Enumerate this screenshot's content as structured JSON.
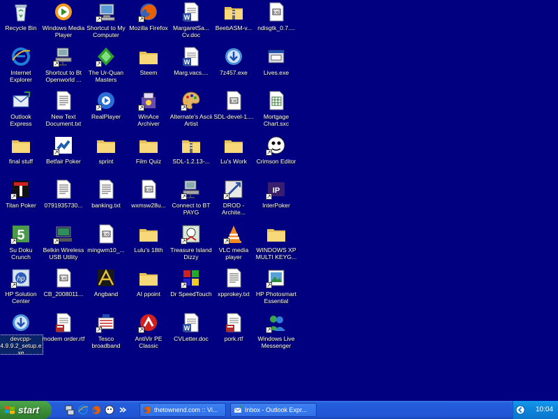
{
  "desktop": {
    "icons": [
      {
        "label": "Recycle Bin",
        "icon": "recycle-bin-icon",
        "shortcut": false
      },
      {
        "label": "Windows Media Player",
        "icon": "media-player-icon",
        "shortcut": false
      },
      {
        "label": "Shortcut to My Computer",
        "icon": "computer-icon",
        "shortcut": true
      },
      {
        "label": "Mozilla Firefox",
        "icon": "firefox-icon",
        "shortcut": true
      },
      {
        "label": "MargaretSa... Cv.doc",
        "icon": "word-doc-icon",
        "shortcut": false
      },
      {
        "label": "BeebASM-v...",
        "icon": "zip-folder-icon",
        "shortcut": false
      },
      {
        "label": "ndisgtk_0.7....",
        "icon": "file-icon",
        "shortcut": false
      },
      {
        "label": "Internet Explorer",
        "icon": "ie-icon",
        "shortcut": false
      },
      {
        "label": "Shortcut to Bt Openworld ...",
        "icon": "network-computer-icon",
        "shortcut": true
      },
      {
        "label": "The Ur-Quan Masters",
        "icon": "game-icon",
        "shortcut": true
      },
      {
        "label": "Steem",
        "icon": "folder-icon",
        "shortcut": false
      },
      {
        "label": "Marg.vacs....",
        "icon": "word-doc-icon",
        "shortcut": false
      },
      {
        "label": "7z457.exe",
        "icon": "installer-icon",
        "shortcut": false
      },
      {
        "label": "Lives.exe",
        "icon": "exe-icon",
        "shortcut": false
      },
      {
        "label": "Outlook Express",
        "icon": "outlook-icon",
        "shortcut": false
      },
      {
        "label": "New Text Document.txt",
        "icon": "text-file-icon",
        "shortcut": false
      },
      {
        "label": "RealPlayer",
        "icon": "realplayer-icon",
        "shortcut": true
      },
      {
        "label": "WinAce Archiver",
        "icon": "winace-icon",
        "shortcut": true
      },
      {
        "label": "Alternate's Ascii Artist",
        "icon": "palette-icon",
        "shortcut": true
      },
      {
        "label": "SDL-devel-1....",
        "icon": "file-icon",
        "shortcut": false
      },
      {
        "label": "Mortgage Chart.sxc",
        "icon": "spreadsheet-icon",
        "shortcut": false
      },
      {
        "label": "final stuff",
        "icon": "folder-icon",
        "shortcut": false
      },
      {
        "label": "Betfair Poker",
        "icon": "betfair-icon",
        "shortcut": true
      },
      {
        "label": "sprint",
        "icon": "folder-icon",
        "shortcut": false
      },
      {
        "label": "Film Quiz",
        "icon": "folder-icon",
        "shortcut": false
      },
      {
        "label": "SDL-1.2.13-...",
        "icon": "zip-folder-icon",
        "shortcut": false
      },
      {
        "label": "Lu's Work",
        "icon": "folder-icon",
        "shortcut": false
      },
      {
        "label": "Crimson Editor",
        "icon": "crimson-editor-icon",
        "shortcut": true
      },
      {
        "label": "Titan Poker",
        "icon": "titan-poker-icon",
        "shortcut": true
      },
      {
        "label": "0791935730...",
        "icon": "text-file-icon",
        "shortcut": false
      },
      {
        "label": "banking.txt",
        "icon": "text-file-icon",
        "shortcut": false
      },
      {
        "label": "wxmsw28u...",
        "icon": "file-icon",
        "shortcut": false
      },
      {
        "label": "Connect to BT PAYG",
        "icon": "network-computer-icon",
        "shortcut": true
      },
      {
        "label": "DROD - Archite...",
        "icon": "drod-icon",
        "shortcut": true
      },
      {
        "label": "InterPoker",
        "icon": "interpoker-icon",
        "shortcut": true
      },
      {
        "label": "Su Doku Crunch",
        "icon": "sudoku-icon",
        "shortcut": true
      },
      {
        "label": "Belkin Wireless USB Utility",
        "icon": "belkin-icon",
        "shortcut": true
      },
      {
        "label": "mingwm10_...",
        "icon": "file-icon",
        "shortcut": false
      },
      {
        "label": "Lulu's 18th",
        "icon": "folder-icon",
        "shortcut": false
      },
      {
        "label": "Treasure Island Dizzy",
        "icon": "dizzy-icon",
        "shortcut": true
      },
      {
        "label": "VLC media player",
        "icon": "vlc-icon",
        "shortcut": true
      },
      {
        "label": "WINDOWS XP MULTI KEYG...",
        "icon": "folder-icon",
        "shortcut": false
      },
      {
        "label": "HP Solution Center",
        "icon": "hp-icon",
        "shortcut": true
      },
      {
        "label": "CB_2008011...",
        "icon": "file-icon",
        "shortcut": false
      },
      {
        "label": "Angband",
        "icon": "angband-icon",
        "shortcut": false
      },
      {
        "label": "AI ppoint",
        "icon": "folder-icon",
        "shortcut": false
      },
      {
        "label": "Dr SpeedTouch",
        "icon": "speedtouch-icon",
        "shortcut": true
      },
      {
        "label": "xpprokey.txt",
        "icon": "text-file-icon",
        "shortcut": false
      },
      {
        "label": "HP Photosmart Essential",
        "icon": "photosmart-icon",
        "shortcut": true
      },
      {
        "label": "devcpp-4.9.9.2_setup.exe",
        "icon": "installer-icon",
        "shortcut": false,
        "selected": true
      },
      {
        "label": "modem order.rtf",
        "icon": "rtf-icon",
        "shortcut": false
      },
      {
        "label": "Tesco broadband",
        "icon": "tesco-icon",
        "shortcut": true
      },
      {
        "label": "AntiVir PE Classic",
        "icon": "antivir-icon",
        "shortcut": true
      },
      {
        "label": "CVLetter.doc",
        "icon": "word-doc-icon",
        "shortcut": false
      },
      {
        "label": "pork.rtf",
        "icon": "rtf-icon",
        "shortcut": false
      },
      {
        "label": "Windows Live Messenger",
        "icon": "messenger-icon",
        "shortcut": true
      }
    ]
  },
  "taskbar": {
    "start_label": "start",
    "quick_launch": [
      "network-icon",
      "ie-icon",
      "firefox-icon",
      "dog-icon",
      "chevron-icon"
    ],
    "tasks": [
      {
        "label": "thetownend.com :: Vi...",
        "icon": "firefox-icon"
      },
      {
        "label": "Inbox - Outlook Expr...",
        "icon": "outlook-icon"
      }
    ],
    "tray_icon": "back-arrow-icon",
    "clock": "10:04"
  },
  "colors": {
    "desktop": "#000080",
    "taskbar": "#245edc",
    "start": "#3c8f3a",
    "tray": "#0d83da"
  }
}
